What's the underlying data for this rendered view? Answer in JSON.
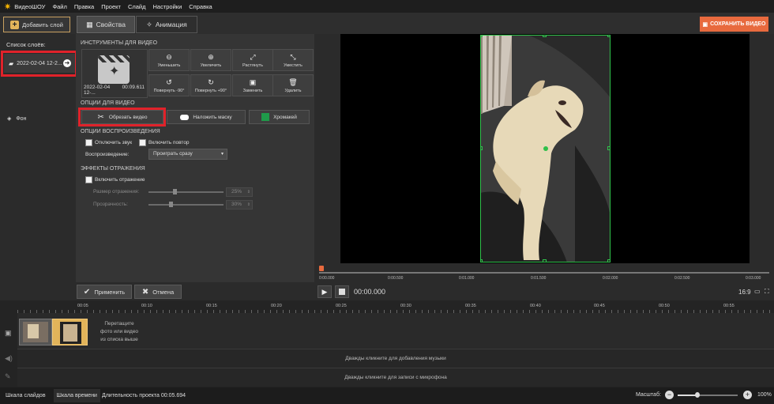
{
  "menu": {
    "app_name": "ВидеоШОУ",
    "items": [
      "Файл",
      "Правка",
      "Проект",
      "Слайд",
      "Настройки",
      "Справка"
    ]
  },
  "toolbar": {
    "add_layer": "Добавить слой",
    "tab_properties": "Свойства",
    "tab_animation": "Анимация",
    "save_video": "СОХРАНИТЬ ВИДЕО"
  },
  "layers": {
    "title": "Список слоёв:",
    "items": [
      {
        "label": "2022-02-04 12-2..."
      },
      {
        "label": "Фон"
      }
    ]
  },
  "props": {
    "tools_title": "ИНСТРУМЕНТЫ ДЛЯ ВИДЕО",
    "thumb_name": "2022-02-04 12-...",
    "thumb_duration": "00:09.611",
    "tools": [
      {
        "icon": "zoom-out-icon",
        "glyph": "⊖",
        "label": "Уменьшить"
      },
      {
        "icon": "zoom-in-icon",
        "glyph": "⊕",
        "label": "Увеличить"
      },
      {
        "icon": "stretch-icon",
        "glyph": "⤢",
        "label": "Растянуть"
      },
      {
        "icon": "fit-icon",
        "glyph": "⤡",
        "label": "Уместить"
      },
      {
        "icon": "rotate-left-icon",
        "glyph": "↺",
        "label": "Повернуть -90°"
      },
      {
        "icon": "rotate-right-icon",
        "glyph": "↻",
        "label": "Повернуть +90°"
      },
      {
        "icon": "replace-icon",
        "glyph": "▣",
        "label": "Заменить"
      },
      {
        "icon": "delete-icon",
        "glyph": "🗑",
        "label": "Удалить"
      }
    ],
    "video_options_title": "ОПЦИИ ДЛЯ ВИДЕО",
    "trim_video": "Обрезать видео",
    "apply_mask": "Наложить маску",
    "chroma_key": "Хромакей",
    "playback_title": "ОПЦИИ ВОСПРОИЗВЕДЕНИЯ",
    "mute": "Отключить звук",
    "loop": "Включить повтор",
    "playback_label": "Воспроизведение:",
    "playback_value": "Проиграть сразу",
    "reflection_title": "ЭФФЕКТЫ ОТРАЖЕНИЯ",
    "enable_reflection": "Включить отражение",
    "reflection_size_label": "Размер отражения:",
    "reflection_size_value": "25%",
    "reflection_size_level": 0.25,
    "transparency_label": "Прозрачность:",
    "transparency_value": "30%",
    "transparency_level": 0.3
  },
  "preview": {
    "ruler_ticks": [
      "0:00.000",
      "0:00.500",
      "0:01.000",
      "0:01.500",
      "0:02.000",
      "0:02.500",
      "0:03.000"
    ],
    "time": "00:00.000",
    "aspect": "16:9"
  },
  "actions": {
    "apply": "Применить",
    "cancel": "Отмена"
  },
  "timeline": {
    "ticks": [
      "00:05",
      "00:10",
      "00:15",
      "00:20",
      "00:25",
      "00:30",
      "00:35",
      "00:40",
      "00:45",
      "00:50",
      "00:55"
    ],
    "drop_hint_1": "Перетащите",
    "drop_hint_2": "фото или видео",
    "drop_hint_3": "из списка выше",
    "music_hint": "Дважды кликните для добавления музыки",
    "mic_hint": "Дважды кликните для записи с микрофона"
  },
  "status": {
    "slides_tab": "Шкала слайдов",
    "timeline_tab": "Шкала времени",
    "duration": "Длительность проекта 00:05.694",
    "zoom_label": "Масштаб:",
    "zoom_value": "100%",
    "zoom_level": 0.33
  },
  "colors": {
    "accent": "#e86a3e",
    "highlight": "#e0222a",
    "selection": "#2fc04a",
    "chroma": "#1f9a4a"
  }
}
